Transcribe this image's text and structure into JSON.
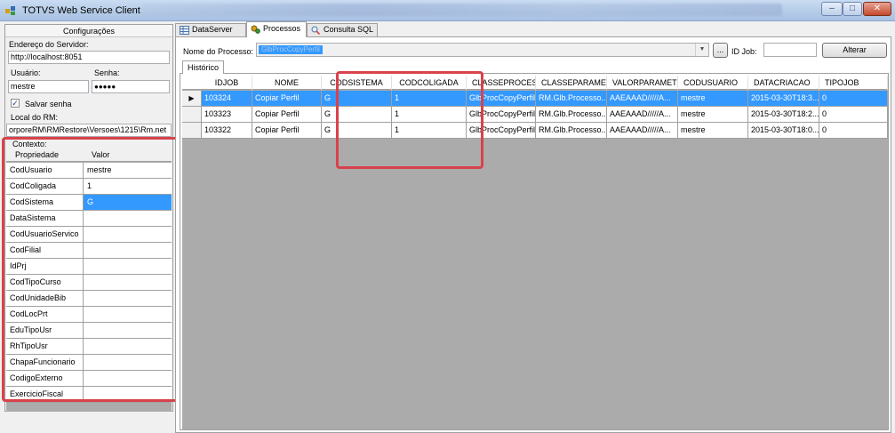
{
  "window": {
    "title": "TOTVS Web Service Client",
    "buttons": {
      "minimize": "–",
      "maximize": "□",
      "close": "✕"
    }
  },
  "config": {
    "header": "Configurações",
    "server_label": "Endereço do Servidor:",
    "server_value": "http://localhost:8051",
    "user_label": "Usuário:",
    "user_value": "mestre",
    "password_label": "Senha:",
    "password_value": "●●●●●",
    "save_password_label": "Salvar senha",
    "save_password_checked": true,
    "rm_path_label": "Local do RM:",
    "rm_path_value": "orporeRM\\RMRestore\\Versoes\\1215\\Rm.net",
    "context_label": "Contexto:",
    "context_headers": [
      "Propriedade",
      "Valor"
    ],
    "context_rows": [
      {
        "prop": "CodUsuario",
        "value": "mestre"
      },
      {
        "prop": "CodColigada",
        "value": "1"
      },
      {
        "prop": "CodSistema",
        "value": "G"
      },
      {
        "prop": "DataSistema",
        "value": ""
      },
      {
        "prop": "CodUsuarioServico",
        "value": ""
      },
      {
        "prop": "CodFilial",
        "value": ""
      },
      {
        "prop": "IdPrj",
        "value": ""
      },
      {
        "prop": "CodTipoCurso",
        "value": ""
      },
      {
        "prop": "CodUnidadeBib",
        "value": ""
      },
      {
        "prop": "CodLocPrt",
        "value": ""
      },
      {
        "prop": "EduTipoUsr",
        "value": ""
      },
      {
        "prop": "RhTipoUsr",
        "value": ""
      },
      {
        "prop": "ChapaFuncionario",
        "value": ""
      },
      {
        "prop": "CodigoExterno",
        "value": ""
      },
      {
        "prop": "ExercicioFiscal",
        "value": ""
      }
    ]
  },
  "tabs": [
    {
      "label": "DataServer",
      "icon": "table-icon"
    },
    {
      "label": "Processos",
      "icon": "gears-icon"
    },
    {
      "label": "Consulta SQL",
      "icon": "magnifier-icon"
    }
  ],
  "processos": {
    "process_label": "Nome do Processo:",
    "process_value": "GlbProcCopyPerfil",
    "browse_label": "...",
    "idjob_label": "ID Job:",
    "idjob_value": "",
    "alter_label": "Alterar",
    "history_tab": "Histórico",
    "columns": [
      "IDJOB",
      "NOME",
      "CODSISTEMA",
      "CODCOLIGADA",
      "CLASSEPROCESS",
      "CLASSEPARAMET",
      "VALORPARAMETI",
      "CODUSUARIO",
      "DATACRIACAO",
      "TIPOJOB"
    ],
    "rows": [
      [
        "103324",
        "Copiar Perfil",
        "G",
        "1",
        "GlbProcCopyPerfil",
        "RM.Glb.Processo...",
        "AAEAAAD/////A...",
        "mestre",
        "2015-03-30T18:3...",
        "0"
      ],
      [
        "103323",
        "Copiar Perfil",
        "G",
        "1",
        "GlbProcCopyPerfil",
        "RM.Glb.Processo...",
        "AAEAAAD/////A...",
        "mestre",
        "2015-03-30T18:2...",
        "0"
      ],
      [
        "103322",
        "Copiar Perfil",
        "G",
        "1",
        "GlbProcCopyPerfil",
        "RM.Glb.Processo...",
        "AAEAAAD/////A...",
        "mestre",
        "2015-03-30T18:0...",
        "0"
      ]
    ],
    "current_row_marker": "▶"
  },
  "colors": {
    "selection": "#3399ff",
    "highlight_box": "#d9424b"
  }
}
